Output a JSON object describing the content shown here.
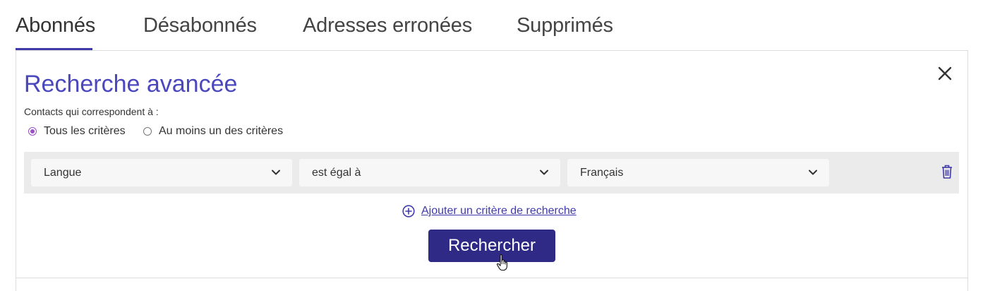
{
  "tabs": [
    {
      "label": "Abonnés",
      "active": true
    },
    {
      "label": "Désabonnés",
      "active": false
    },
    {
      "label": "Adresses erronées",
      "active": false
    },
    {
      "label": "Supprimés",
      "active": false
    }
  ],
  "panel": {
    "title": "Recherche avancée",
    "subtitle": "Contacts qui correspondent à :",
    "match_options": [
      {
        "label": "Tous les critères",
        "selected": true
      },
      {
        "label": "Au moins un des critères",
        "selected": false
      }
    ],
    "criteria": [
      {
        "field": "Langue",
        "operator": "est égal à",
        "value": "Français"
      }
    ],
    "add_criteria_label": "Ajouter un critère de recherche",
    "search_button_label": "Rechercher"
  },
  "icons": {
    "close": "close-icon",
    "chevron": "chevron-down-icon",
    "trash": "trash-icon",
    "add": "plus-circle-icon",
    "cursor": "hand-cursor-icon"
  },
  "colors": {
    "accent": "#3f3aa8",
    "title": "#4b47bd",
    "button": "#2e2a86",
    "radio_selected": "#9a4fc7",
    "row_background": "#ebebeb"
  }
}
